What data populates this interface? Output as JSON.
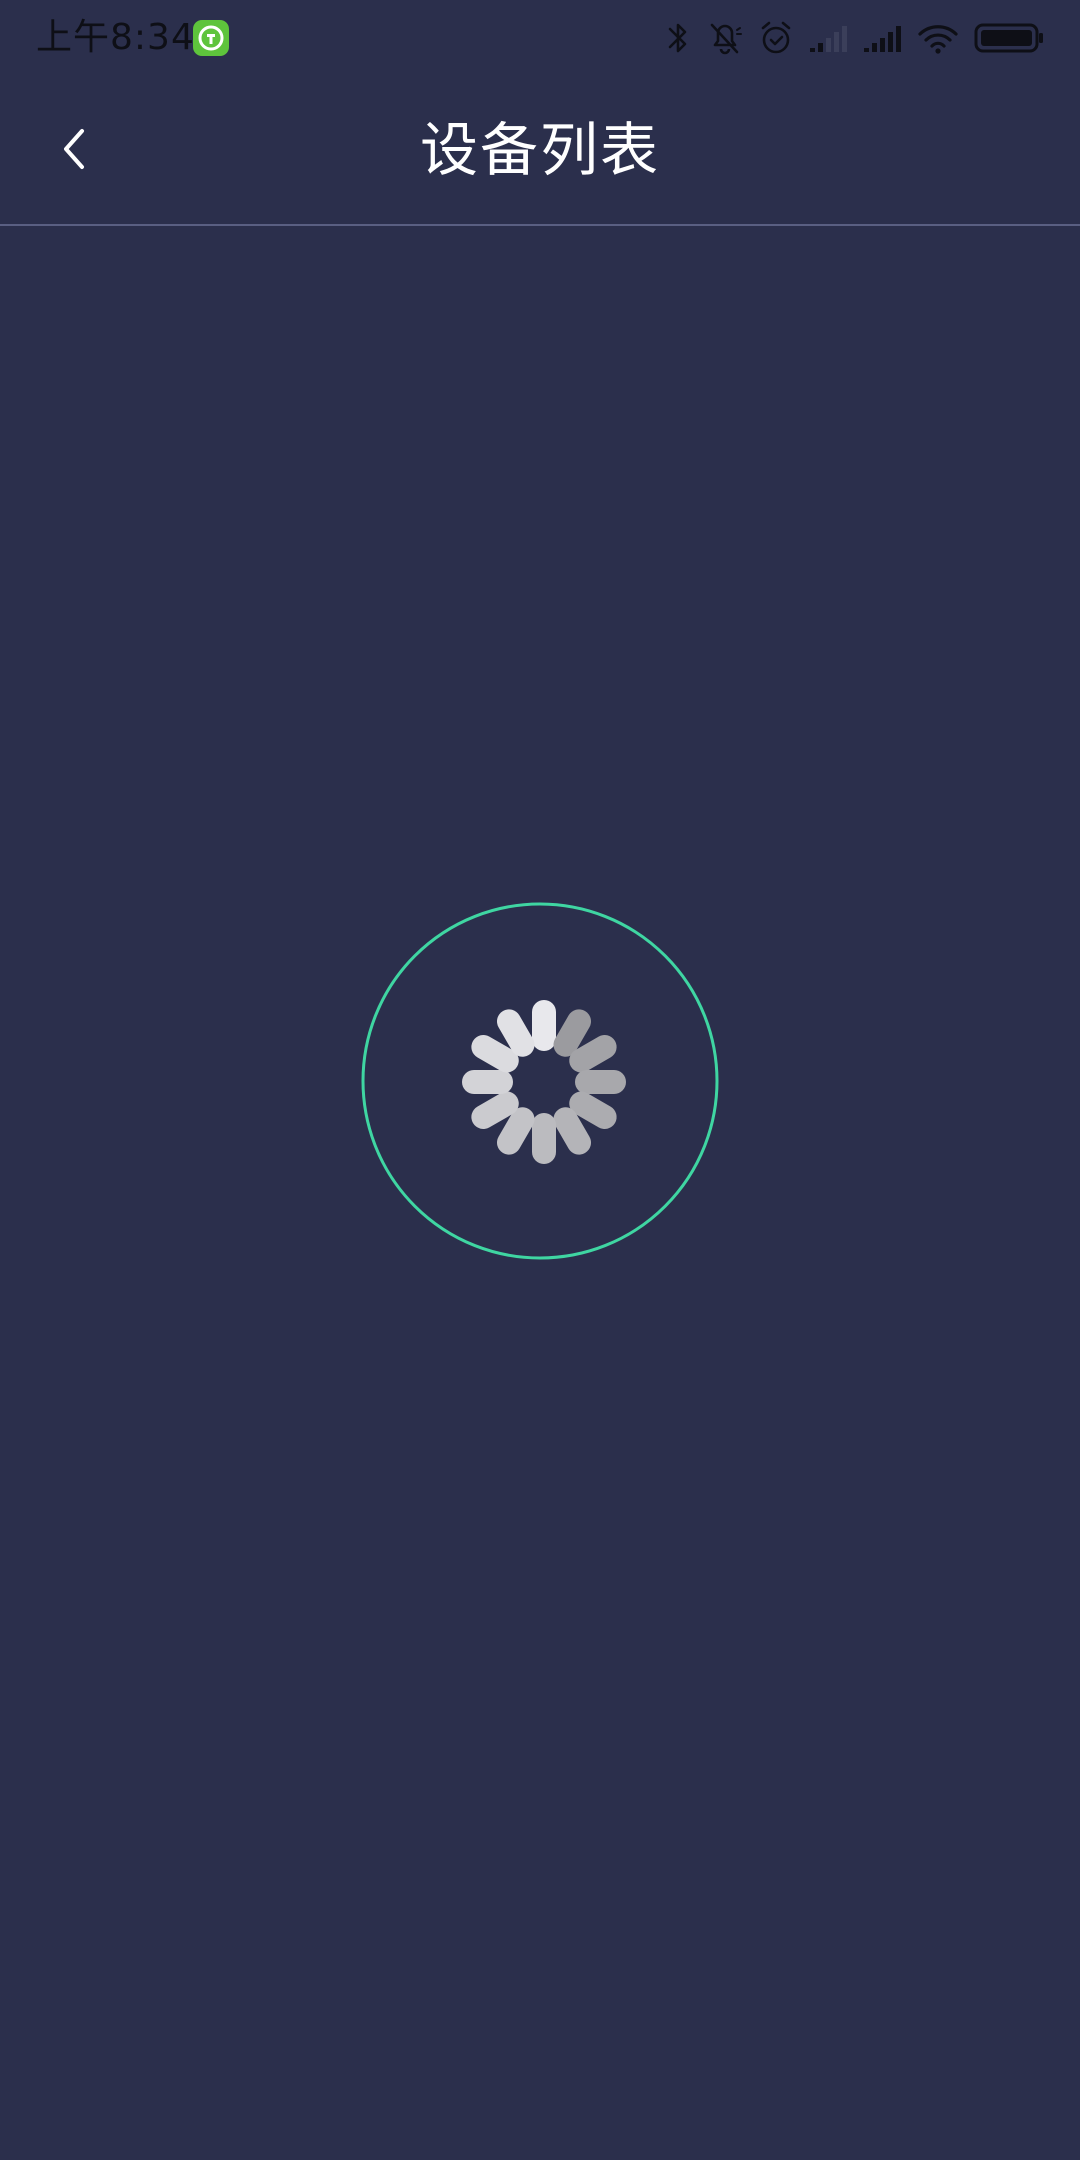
{
  "status_bar": {
    "time": "上午8:34",
    "icons": [
      "app-badge-icon",
      "bluetooth-icon",
      "mute-bell-icon",
      "alarm-icon",
      "signal-sim1-icon",
      "signal-sim2-icon",
      "wifi-icon",
      "battery-icon"
    ]
  },
  "header": {
    "title": "设备列表",
    "back_icon": "chevron-left-icon"
  },
  "loading": {
    "icon": "spinner-icon",
    "ring_color": "#3fd6a2"
  },
  "colors": {
    "background": "#2b2f4c",
    "title": "#ffffff",
    "divider": "#5a5f82",
    "app_badge": "#5ec43c"
  }
}
